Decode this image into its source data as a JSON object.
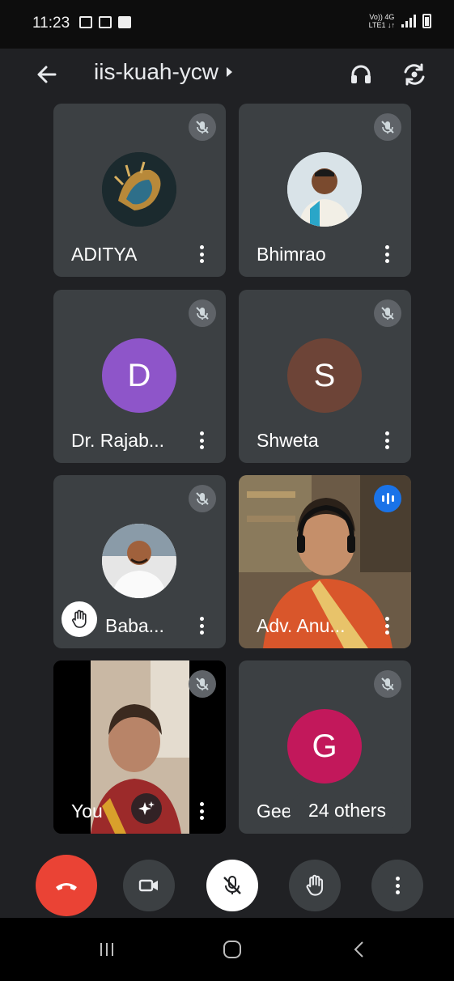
{
  "status_bar": {
    "time": "11:23",
    "network_line1": "Vo)) 4G",
    "network_line2": "LTE1 ↓↑"
  },
  "header": {
    "meeting_code": "iis-kuah-ycw"
  },
  "tiles": [
    {
      "name": "ADITYA",
      "avatar_color": "#1b2a2e",
      "muted": true
    },
    {
      "name": "Bhimrao",
      "avatar_color": "#cfd8dc",
      "muted": true
    },
    {
      "name": "Dr. Rajab...",
      "initial": "D",
      "avatar_color": "#8e55c9",
      "muted": true
    },
    {
      "name": "Shweta",
      "initial": "S",
      "avatar_color": "#6d4437",
      "muted": true
    },
    {
      "name": "Baba...",
      "avatar_color": "#cfd8dc",
      "muted": true,
      "hand_raised": true
    },
    {
      "name": "Adv. Anu...",
      "speaking": true
    },
    {
      "name": "You",
      "muted": true
    },
    {
      "name": "Geet",
      "initial": "G",
      "avatar_color": "#c2185b",
      "muted": true
    }
  ],
  "others_label": "24 others",
  "colors": {
    "end_call": "#ea4335",
    "speaking": "#1a73e8",
    "tile_bg": "#3c4043",
    "meet_bg": "#202124"
  }
}
